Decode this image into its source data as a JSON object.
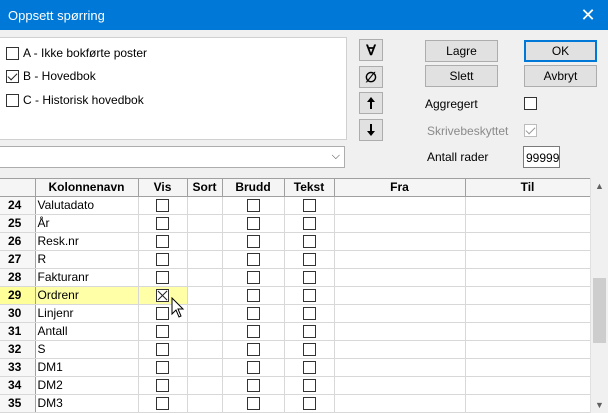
{
  "window": {
    "title": "Oppsett spørring",
    "close_glyph": "✕"
  },
  "sources": [
    {
      "label": "A - Ikke bokførte poster",
      "checked": false
    },
    {
      "label": "B - Hovedbok",
      "checked": true
    },
    {
      "label": "C - Historisk hovedbok",
      "checked": false
    }
  ],
  "side_buttons": {
    "filter": "∀",
    "clear": "∅",
    "up": "🠕",
    "down": "🠗"
  },
  "buttons": {
    "save": "Lagre",
    "ok": "OK",
    "delete": "Slett",
    "cancel": "Avbryt"
  },
  "options": {
    "aggregated_label": "Aggregert",
    "aggregated_checked": false,
    "readonly_label": "Skrivebeskyttet",
    "readonly_checked": true,
    "rows_label": "Antall rader",
    "rows_value": "99999"
  },
  "combo": {
    "value": "",
    "arrow_glyph": "⌵"
  },
  "grid": {
    "columns": [
      "",
      "Kolonnenavn",
      "Vis",
      "Sort",
      "Brudd",
      "Tekst",
      "Fra",
      "Til"
    ],
    "rows": [
      {
        "num": "24",
        "name": "Valutadato"
      },
      {
        "num": "25",
        "name": "År"
      },
      {
        "num": "26",
        "name": "Resk.nr"
      },
      {
        "num": "27",
        "name": "R"
      },
      {
        "num": "28",
        "name": "Fakturanr"
      },
      {
        "num": "29",
        "name": "Ordrenr",
        "selected": true
      },
      {
        "num": "30",
        "name": "Linjenr"
      },
      {
        "num": "31",
        "name": "Antall"
      },
      {
        "num": "32",
        "name": "S"
      },
      {
        "num": "33",
        "name": "DM1"
      },
      {
        "num": "34",
        "name": "DM2"
      },
      {
        "num": "35",
        "name": "DM3"
      }
    ]
  },
  "scroll": {
    "up_glyph": "▲",
    "down_glyph": "▼"
  }
}
